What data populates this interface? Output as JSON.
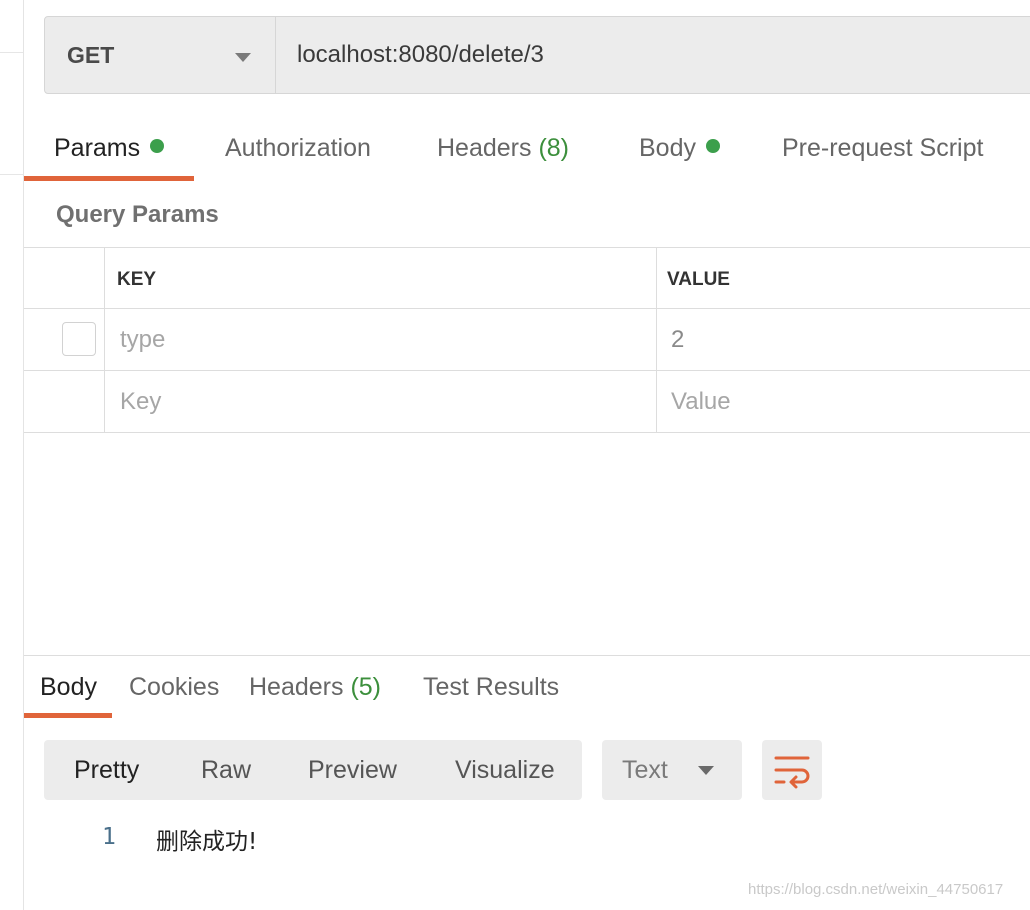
{
  "request": {
    "method": "GET",
    "url": "localhost:8080/delete/3"
  },
  "request_tabs": [
    {
      "label": "Params",
      "active": true,
      "dot": true
    },
    {
      "label": "Authorization"
    },
    {
      "label": "Headers",
      "count": "(8)"
    },
    {
      "label": "Body",
      "dot": true
    },
    {
      "label": "Pre-request Script"
    }
  ],
  "query_params": {
    "title": "Query Params",
    "columns": [
      "KEY",
      "VALUE"
    ],
    "rows": [
      {
        "key": "type",
        "value": "2"
      }
    ],
    "placeholder_row": {
      "key": "Key",
      "value": "Value"
    }
  },
  "response_tabs": [
    {
      "label": "Body",
      "active": true
    },
    {
      "label": "Cookies"
    },
    {
      "label": "Headers",
      "count": "(5)"
    },
    {
      "label": "Test Results"
    }
  ],
  "view_modes": [
    "Pretty",
    "Raw",
    "Preview",
    "Visualize"
  ],
  "format": "Text",
  "response_body": {
    "line_number": "1",
    "text": "删除成功!"
  },
  "watermark": "https://blog.csdn.net/weixin_44750617",
  "colors": {
    "accent": "#e0643a",
    "status_green": "#3c9f4c"
  },
  "icons": {
    "method_dropdown": "chevron-down-icon",
    "format_dropdown": "chevron-down-icon",
    "wrap": "wrap-lines-icon",
    "status_dot": "green-dot-icon"
  }
}
